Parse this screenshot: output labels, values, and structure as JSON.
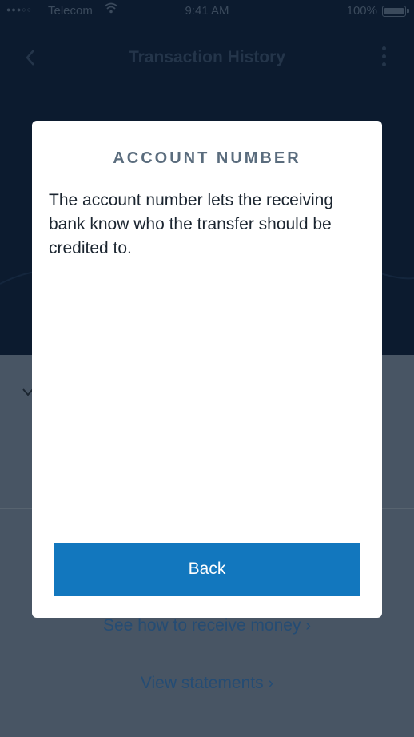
{
  "status_bar": {
    "carrier": "Telecom",
    "time": "9:41 AM",
    "battery": "100%"
  },
  "nav": {
    "title": "Transaction History"
  },
  "links": {
    "receive_money": "See how to receive money",
    "view_statements": "View statements"
  },
  "modal": {
    "title": "ACCOUNT NUMBER",
    "body": "The account number lets the receiving bank know who the transfer should be credited to.",
    "back_label": "Back"
  },
  "colors": {
    "header_bg": "#0c1b2f",
    "overlay_bg": "#485564",
    "button_bg": "#1277be",
    "modal_bg": "#ffffff"
  }
}
